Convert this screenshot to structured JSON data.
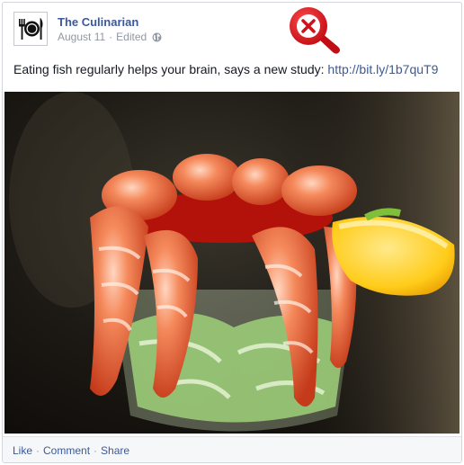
{
  "post": {
    "page_name": "The Culinarian",
    "date": "August 11",
    "edited": "Edited",
    "text": "Eating fish regularly helps your brain, says a new study: ",
    "link": "http://bit.ly/1b7quT9"
  },
  "actions": {
    "like": "Like",
    "comment": "Comment",
    "share": "Share",
    "separator": "·"
  },
  "icons": {
    "avatar": "plate-fork-knife-icon",
    "privacy": "globe-icon",
    "overlay": "close-icon"
  },
  "colors": {
    "link": "#3b5998",
    "meta": "#9197a3",
    "close_marker": "#e5202a"
  }
}
